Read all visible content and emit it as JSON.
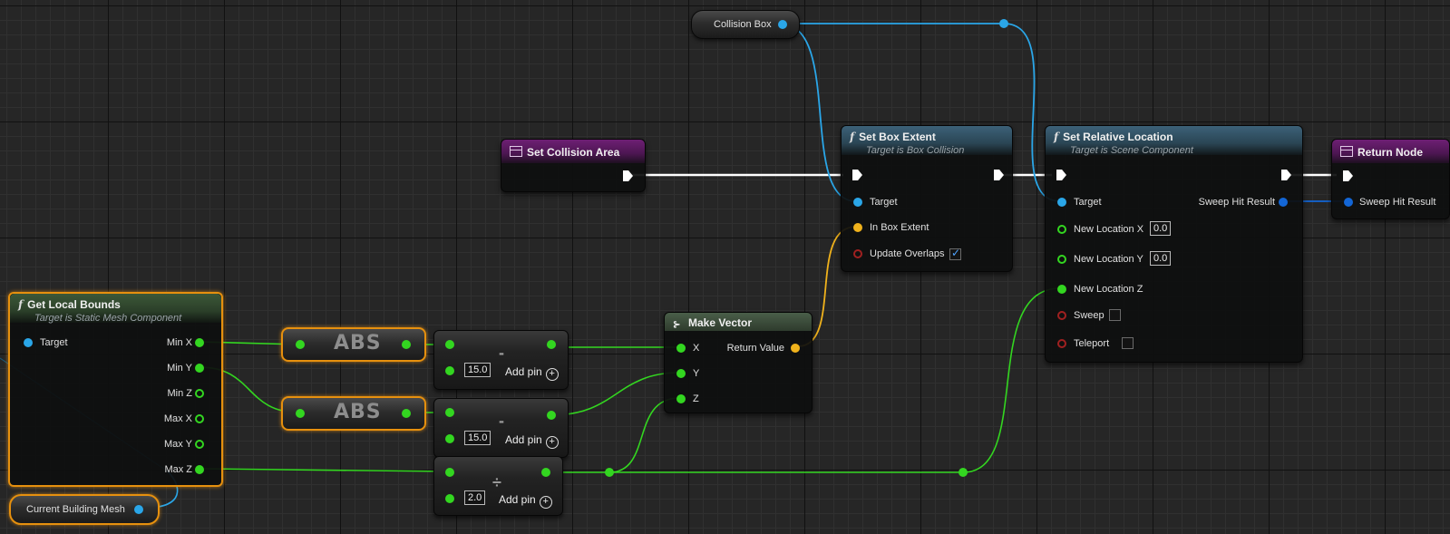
{
  "colors": {
    "exec_wire": "#ffffff",
    "object_wire": "#2aa6e8",
    "float_wire": "#33d620",
    "vector_wire": "#f0b21c",
    "struct_wire": "#1366d6",
    "selection_outline": "#e6900e"
  },
  "icons": {
    "function": "function-icon",
    "event": "event-grid-icon",
    "make_vector": "make-struct-icon"
  },
  "nodes": {
    "collision_box": {
      "label": "Collision Box"
    },
    "set_collision_area": {
      "title": "Set Collision Area"
    },
    "set_box_extent": {
      "title": "Set Box Extent",
      "subtitle": "Target is Box Collision",
      "pins": {
        "target": "Target",
        "in_box_extent": "In Box Extent",
        "update_overlaps": "Update Overlaps"
      },
      "update_overlaps_checked": true
    },
    "set_relative_location": {
      "title": "Set Relative Location",
      "subtitle": "Target is Scene Component",
      "pins": {
        "target": "Target",
        "sweep_hit_result": "Sweep Hit Result",
        "new_location_x": "New Location X",
        "new_location_y": "New Location Y",
        "new_location_z": "New Location Z",
        "sweep": "Sweep",
        "teleport": "Teleport"
      },
      "new_location_x_value": "0.0",
      "new_location_y_value": "0.0",
      "sweep_checked": false,
      "teleport_checked": false
    },
    "return_node": {
      "title": "Return Node",
      "pins": {
        "sweep_hit_result": "Sweep Hit Result"
      }
    },
    "get_local_bounds": {
      "title": "Get Local Bounds",
      "subtitle": "Target is Static Mesh Component",
      "pins": {
        "target": "Target",
        "min_x": "Min X",
        "min_y": "Min Y",
        "min_z": "Min Z",
        "max_x": "Max X",
        "max_y": "Max Y",
        "max_z": "Max Z"
      }
    },
    "current_building_mesh": {
      "label": "Current Building Mesh"
    },
    "abs_1": {
      "label": "ABS"
    },
    "abs_2": {
      "label": "ABS"
    },
    "subtract_1": {
      "operator": "-",
      "value": "15.0",
      "add_pin": "Add pin"
    },
    "subtract_2": {
      "operator": "-",
      "value": "15.0",
      "add_pin": "Add pin"
    },
    "divide": {
      "operator": "÷",
      "value": "2.0",
      "add_pin": "Add pin"
    },
    "make_vector": {
      "title": "Make Vector",
      "pins": {
        "x": "X",
        "y": "Y",
        "z": "Z",
        "return_value": "Return Value"
      }
    }
  }
}
